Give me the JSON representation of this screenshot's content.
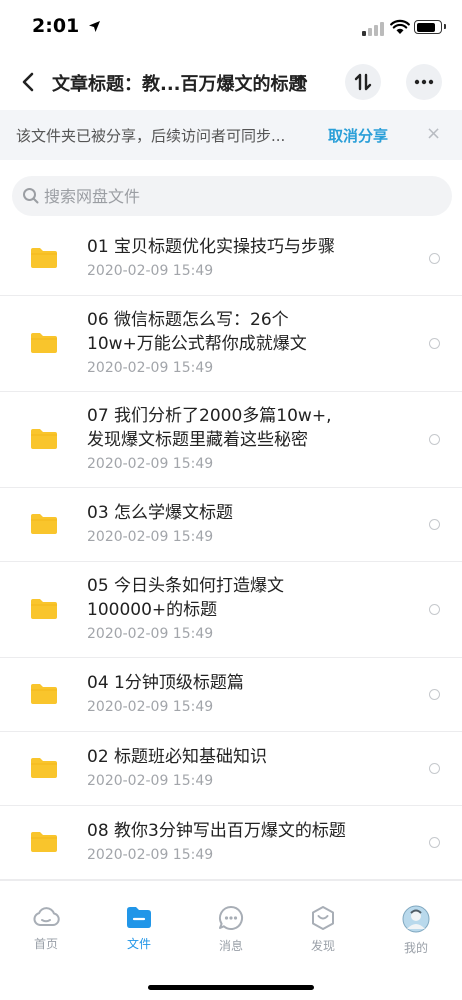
{
  "status": {
    "time": "2:01"
  },
  "nav": {
    "title": "文章标题：教...百万爆文的标题"
  },
  "banner": {
    "text": "该文件夹已被分享，后续访问者可同步...",
    "cancel": "取消分享",
    "close": "×"
  },
  "search": {
    "placeholder": "搜索网盘文件"
  },
  "files": [
    {
      "line1": "01 宝贝标题优化实操技巧与步骤",
      "line2": "",
      "date": "2020-02-09 15:49"
    },
    {
      "line1": "06 微信标题怎么写：26个",
      "line2": "10w+万能公式帮你成就爆文",
      "date": "2020-02-09 15:49"
    },
    {
      "line1": "07 我们分析了2000多篇10w+,",
      "line2": "发现爆文标题里藏着这些秘密",
      "date": "2020-02-09 15:49"
    },
    {
      "line1": "03 怎么学爆文标题",
      "line2": "",
      "date": "2020-02-09 15:49"
    },
    {
      "line1": "05 今日头条如何打造爆文",
      "line2": "100000+的标题",
      "date": "2020-02-09 15:49"
    },
    {
      "line1": "04 1分钟顶级标题篇",
      "line2": "",
      "date": "2020-02-09 15:49"
    },
    {
      "line1": "02 标题班必知基础知识",
      "line2": "",
      "date": "2020-02-09 15:49"
    },
    {
      "line1": "08 教你3分钟写出百万爆文的标题",
      "line2": "",
      "date": "2020-02-09 15:49"
    }
  ],
  "tabs": [
    {
      "label": "首页",
      "icon": "cloud-icon"
    },
    {
      "label": "文件",
      "icon": "folder-icon"
    },
    {
      "label": "消息",
      "icon": "chat-icon"
    },
    {
      "label": "发现",
      "icon": "discover-icon"
    },
    {
      "label": "我的",
      "icon": "avatar-icon"
    }
  ],
  "colors": {
    "accent": "#2196e8",
    "folder": "#f9c52c",
    "link": "#2a9fd8"
  }
}
